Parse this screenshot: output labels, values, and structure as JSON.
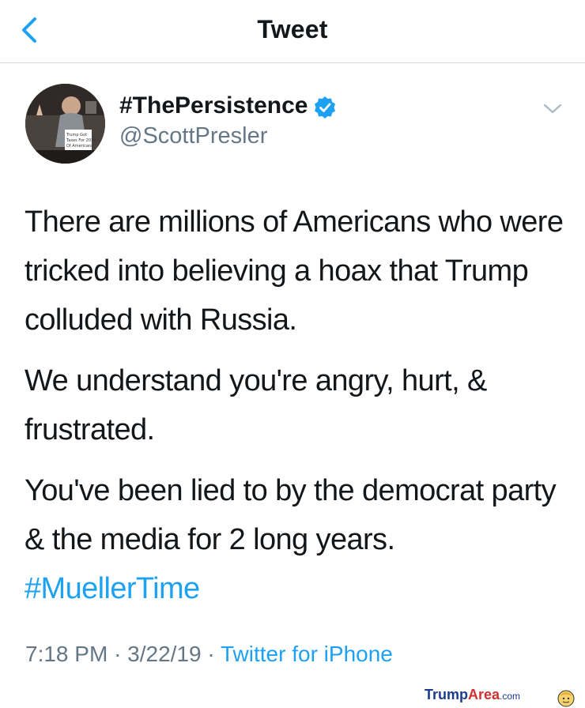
{
  "header": {
    "title": "Tweet"
  },
  "author": {
    "display_name": "#ThePersistence",
    "handle": "@ScottPresler",
    "sign_text": "Trump Got Taxes For 2018 Of Americans"
  },
  "tweet": {
    "paragraphs": [
      "There are millions of Americans who were tricked into believing a hoax that Trump colluded with Russia.",
      "We understand you're angry, hurt, & frustrated.",
      "You've been lied to by the democrat party & the media for 2 long years."
    ],
    "hashtag": "#MuellerTime"
  },
  "meta": {
    "time": "7:18 PM",
    "separator": "·",
    "date": "3/22/19",
    "source": "Twitter for iPhone"
  },
  "watermark": {
    "part1": "Trump",
    "part2": "Area",
    "part3": ".com"
  },
  "colors": {
    "link": "#1da1f2",
    "secondary": "#657786",
    "text": "#14171a"
  }
}
